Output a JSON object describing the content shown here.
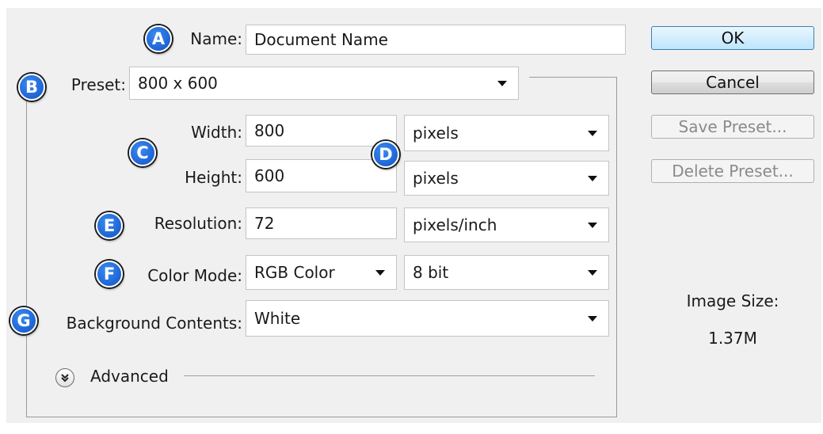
{
  "badges": {
    "a": "A",
    "b": "B",
    "c": "C",
    "d": "D",
    "e": "E",
    "f": "F",
    "g": "G"
  },
  "name": {
    "label": "Name:",
    "value": "Document Name"
  },
  "preset": {
    "label": "Preset:",
    "value": "800 x 600"
  },
  "width": {
    "label": "Width:",
    "value": "800",
    "unit": "pixels"
  },
  "height": {
    "label": "Height:",
    "value": "600",
    "unit": "pixels"
  },
  "resolution": {
    "label": "Resolution:",
    "value": "72",
    "unit": "pixels/inch"
  },
  "color_mode": {
    "label": "Color Mode:",
    "value": "RGB Color",
    "depth": "8 bit"
  },
  "background": {
    "label": "Background Contents:",
    "value": "White"
  },
  "advanced": {
    "label": "Advanced"
  },
  "buttons": {
    "ok": "OK",
    "cancel": "Cancel",
    "save_preset": "Save Preset...",
    "delete_preset": "Delete Preset..."
  },
  "image_size": {
    "label": "Image Size:",
    "value": "1.37M"
  }
}
